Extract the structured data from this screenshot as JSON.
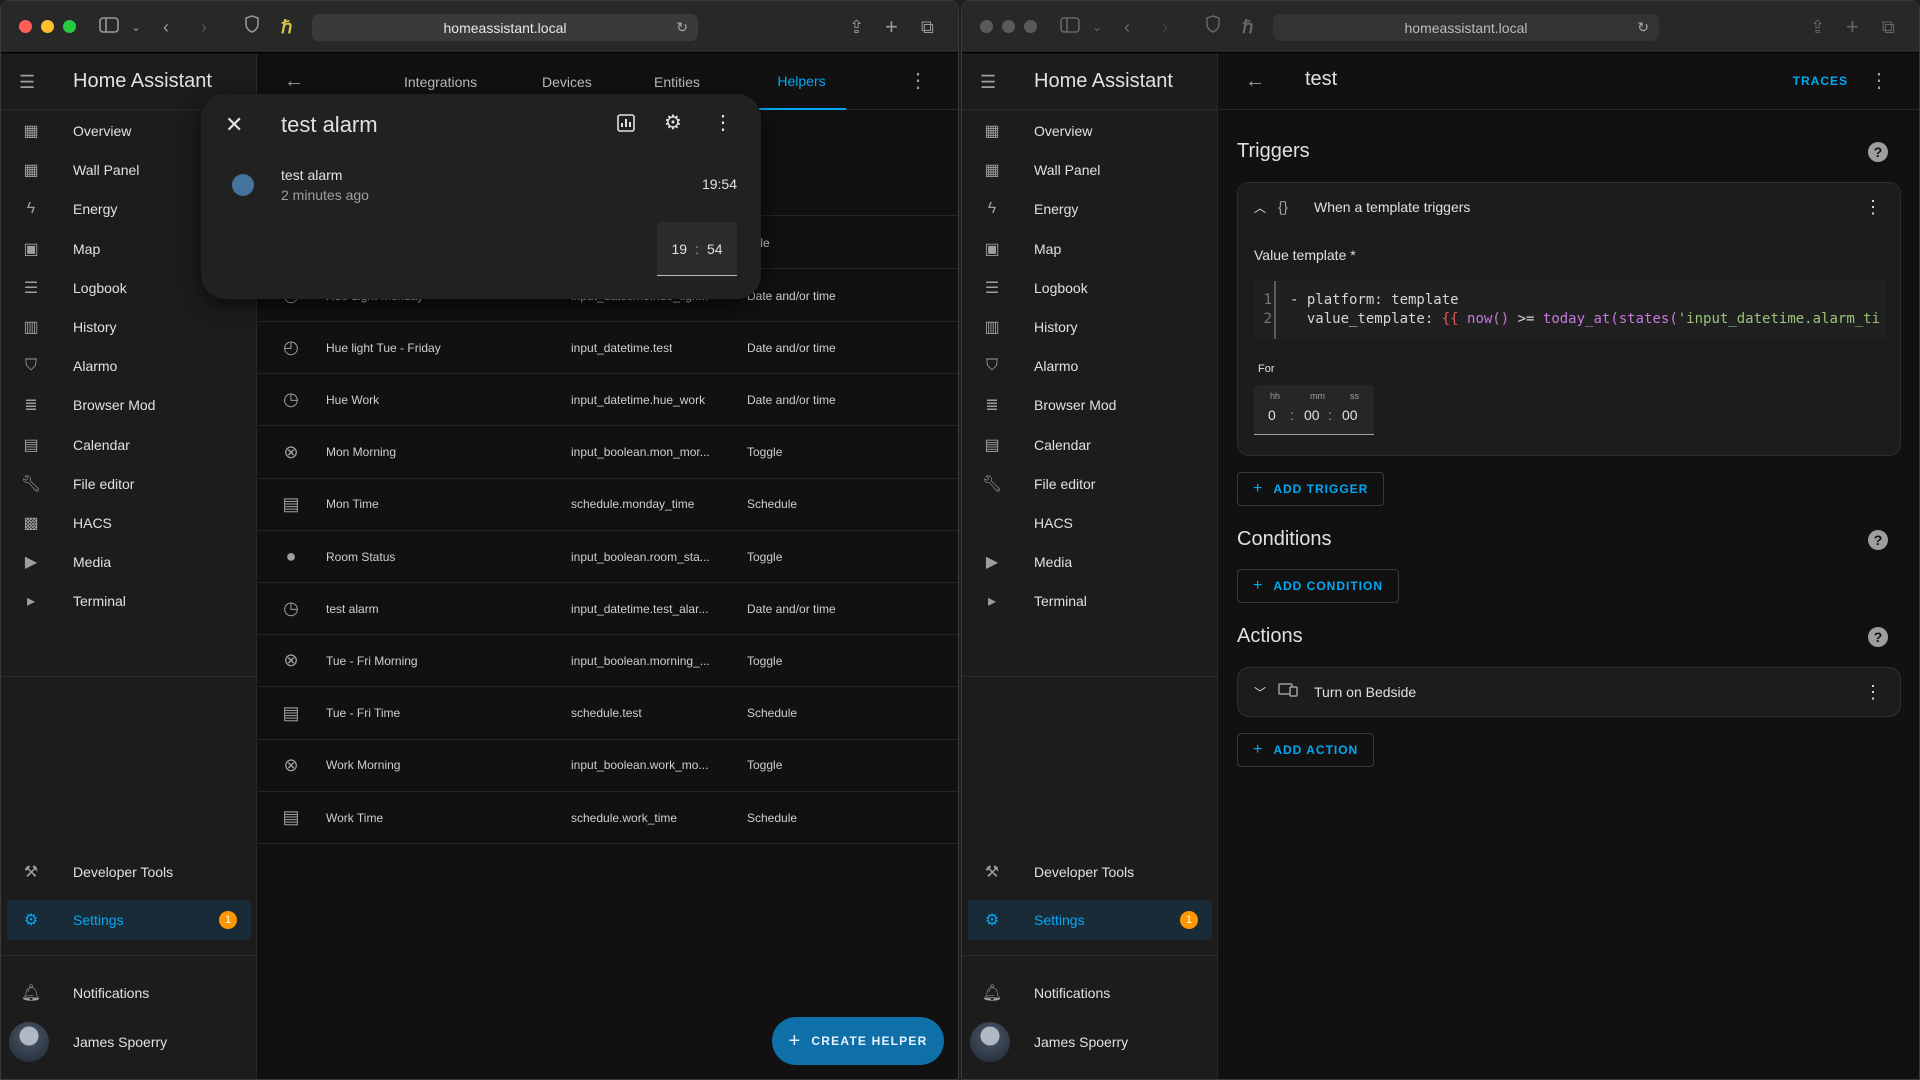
{
  "browser": {
    "url": "homeassistant.local"
  },
  "sidebar": {
    "title": "Home Assistant",
    "items": [
      {
        "label": "Overview",
        "icon": "view-dashboard-icon"
      },
      {
        "label": "Wall Panel",
        "icon": "view-dashboard-icon"
      },
      {
        "label": "Energy",
        "icon": "lightning-bolt-icon"
      },
      {
        "label": "Map",
        "icon": "account-box-icon"
      },
      {
        "label": "Logbook",
        "icon": "format-list-bulleted-icon"
      },
      {
        "label": "History",
        "icon": "chart-box-icon"
      },
      {
        "label": "Alarmo",
        "icon": "shield-icon"
      },
      {
        "label": "Browser Mod",
        "icon": "server-icon"
      },
      {
        "label": "Calendar",
        "icon": "calendar-icon"
      },
      {
        "label": "File editor",
        "icon": "wrench-icon"
      },
      {
        "label": "HACS",
        "icon": "hacs-icon"
      },
      {
        "label": "Media",
        "icon": "play-box-icon"
      },
      {
        "label": "Terminal",
        "icon": "console-icon"
      }
    ],
    "developer_tools": "Developer Tools",
    "settings": "Settings",
    "settings_badge": "1",
    "notifications": "Notifications",
    "user": "James Spoerry"
  },
  "left": {
    "tabs": [
      "Integrations",
      "Devices",
      "Entities",
      "Helpers"
    ],
    "active_tab": "Helpers",
    "header_partial": {
      "type_col": "pe",
      "first_type": "ggle"
    },
    "rows": [
      {
        "name": "Hue Light Monday",
        "entity": "input_datetime.hue_ligh...",
        "type": "Date and/or time",
        "icon": "clock-icon"
      },
      {
        "name": "Hue light Tue - Friday",
        "entity": "input_datetime.test",
        "type": "Date and/or time",
        "icon": "clock-cog-icon"
      },
      {
        "name": "Hue Work",
        "entity": "input_datetime.hue_work",
        "type": "Date and/or time",
        "icon": "clock-icon"
      },
      {
        "name": "Mon Morning",
        "entity": "input_boolean.mon_mor...",
        "type": "Toggle",
        "icon": "close-circle-icon"
      },
      {
        "name": "Mon Time",
        "entity": "schedule.monday_time",
        "type": "Schedule",
        "icon": "calendar-clock-icon"
      },
      {
        "name": "Room Status",
        "entity": "input_boolean.room_sta...",
        "type": "Toggle",
        "icon": "account-icon"
      },
      {
        "name": "test alarm",
        "entity": "input_datetime.test_alar...",
        "type": "Date and/or time",
        "icon": "clock-icon"
      },
      {
        "name": "Tue - Fri Morning",
        "entity": "input_boolean.morning_...",
        "type": "Toggle",
        "icon": "close-circle-icon"
      },
      {
        "name": "Tue - Fri Time",
        "entity": "schedule.test",
        "type": "Schedule",
        "icon": "calendar-clock-icon"
      },
      {
        "name": "Work Morning",
        "entity": "input_boolean.work_mo...",
        "type": "Toggle",
        "icon": "close-circle-icon"
      },
      {
        "name": "Work Time",
        "entity": "schedule.work_time",
        "type": "Schedule",
        "icon": "calendar-clock-icon"
      }
    ],
    "fab_label": "CREATE HELPER",
    "dialog": {
      "title": "test alarm",
      "entity_name": "test alarm",
      "last_changed": "2 minutes ago",
      "state": "19:54",
      "hour": "19",
      "minute": "54"
    }
  },
  "right": {
    "title": "test",
    "traces_label": "TRACES",
    "triggers_title": "Triggers",
    "trigger_label": "When a template triggers",
    "value_template_label": "Value template *",
    "code_line_numbers": [
      "1",
      "2"
    ],
    "code_line1": "- platform: template",
    "code_line2_prefix": "  value_template: ",
    "code_line2_open": "{{ ",
    "code_line2_fn1": "now()",
    "code_line2_op": " >= ",
    "code_line2_fn2": "today_at(states(",
    "code_line2_str": "'input_datetime.alarm_ti",
    "for_label": "For",
    "duration": {
      "hh_label": "hh",
      "mm_label": "mm",
      "ss_label": "ss",
      "hh": "0",
      "mm": "00",
      "ss": "00"
    },
    "add_trigger": "ADD TRIGGER",
    "conditions_title": "Conditions",
    "add_condition": "ADD CONDITION",
    "actions_title": "Actions",
    "action_label": "Turn on Bedside",
    "add_action": "ADD ACTION"
  },
  "colors": {
    "accent": "#03a9f4",
    "badge": "#ff9800",
    "close": "#ff5f57",
    "minimize": "#febc2e",
    "zoom": "#28c840"
  }
}
